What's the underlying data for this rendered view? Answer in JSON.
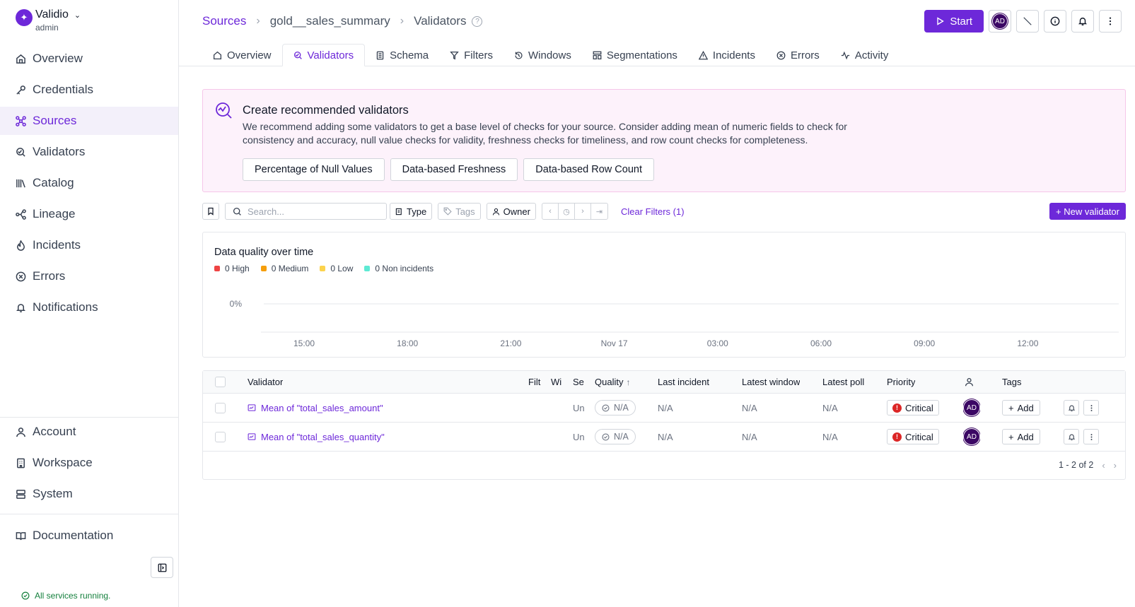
{
  "brand": {
    "name": "Validio",
    "role": "admin"
  },
  "sidebar": {
    "items": [
      {
        "label": "Overview"
      },
      {
        "label": "Credentials"
      },
      {
        "label": "Sources"
      },
      {
        "label": "Validators"
      },
      {
        "label": "Catalog"
      },
      {
        "label": "Lineage"
      },
      {
        "label": "Incidents"
      },
      {
        "label": "Errors"
      },
      {
        "label": "Notifications"
      }
    ],
    "bottom_items": [
      {
        "label": "Account"
      },
      {
        "label": "Workspace"
      },
      {
        "label": "System"
      }
    ],
    "documentation": "Documentation",
    "status": "All services running."
  },
  "breadcrumb": {
    "root": "Sources",
    "source": "gold__sales_summary",
    "page": "Validators"
  },
  "header": {
    "start_label": "Start",
    "avatar": "AD",
    "help_glyph": "?"
  },
  "tabs": [
    "Overview",
    "Validators",
    "Schema",
    "Filters",
    "Windows",
    "Segmentations",
    "Incidents",
    "Errors",
    "Activity"
  ],
  "banner": {
    "title": "Create recommended validators",
    "text": "We recommend adding some validators to get a base level of checks for your source. Consider adding mean of numeric fields to check for consistency and accuracy, null value checks for validity, freshness checks for timeliness, and row count checks for completeness.",
    "buttons": [
      "Percentage of Null Values",
      "Data-based Freshness",
      "Data-based Row Count"
    ]
  },
  "filters": {
    "search_placeholder": "Search...",
    "type": "Type",
    "tags": "Tags",
    "owner": "Owner",
    "clear": "Clear Filters (1)",
    "new_validator": "+ New validator"
  },
  "chart_data": {
    "type": "line",
    "title": "Data quality over time",
    "legend": [
      {
        "label": "0 High",
        "color": "#ef4444"
      },
      {
        "label": "0 Medium",
        "color": "#f59e0b"
      },
      {
        "label": "0 Low",
        "color": "#fcd34d"
      },
      {
        "label": "0 Non incidents",
        "color": "#5eead4"
      }
    ],
    "y_tick": "0%",
    "x_ticks": [
      "15:00",
      "18:00",
      "21:00",
      "Nov 17",
      "03:00",
      "06:00",
      "09:00",
      "12:00"
    ],
    "series": []
  },
  "table": {
    "headers": {
      "validator": "Validator",
      "filter": "Filt",
      "window": "Wi",
      "segment": "Se",
      "quality": "Quality",
      "quality_sort": "↑",
      "last_incident": "Last incident",
      "latest_window": "Latest window",
      "latest_poll": "Latest poll",
      "priority": "Priority",
      "tags": "Tags"
    },
    "rows": [
      {
        "name": "Mean of \"total_sales_amount\"",
        "segment": "Un",
        "quality": "N/A",
        "last_incident": "N/A",
        "latest_window": "N/A",
        "latest_poll": "N/A",
        "priority": "Critical",
        "owner": "AD",
        "add": "Add"
      },
      {
        "name": "Mean of \"total_sales_quantity\"",
        "segment": "Un",
        "quality": "N/A",
        "last_incident": "N/A",
        "latest_window": "N/A",
        "latest_poll": "N/A",
        "priority": "Critical",
        "owner": "AD",
        "add": "Add"
      }
    ],
    "pagination": "1 - 2 of 2"
  }
}
